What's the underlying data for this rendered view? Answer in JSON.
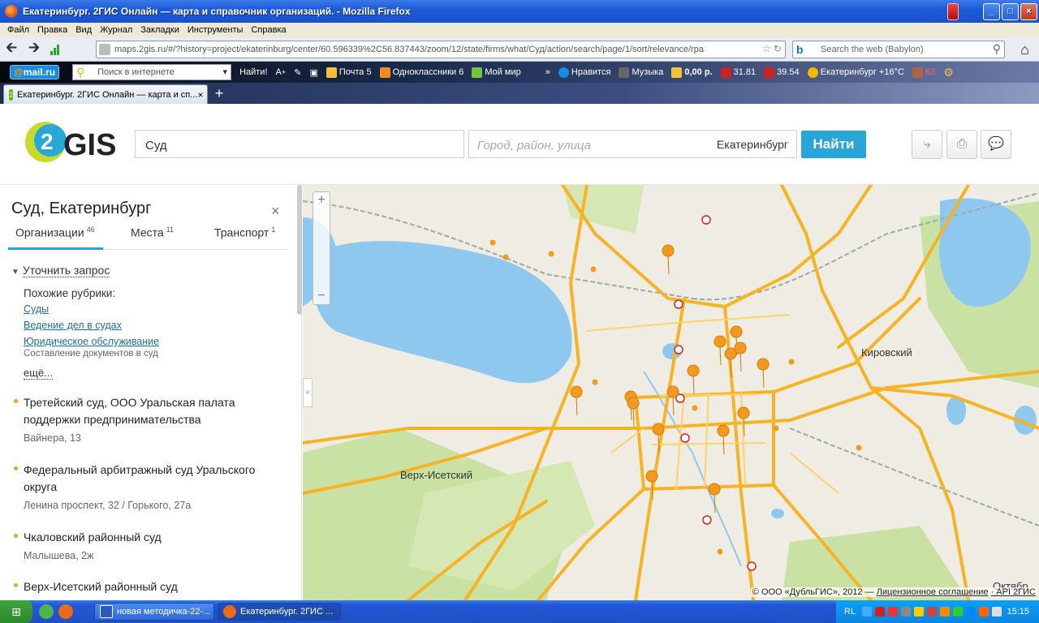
{
  "window": {
    "title": "Екатеринбург. 2ГИС Онлайн — карта и справочник организаций. - Mozilla Firefox",
    "buttons": [
      "_",
      "□",
      "×"
    ]
  },
  "menu": [
    "Файл",
    "Правка",
    "Вид",
    "Журнал",
    "Закладки",
    "Инструменты",
    "Справка"
  ],
  "nav": {
    "url": "maps.2gis.ru/#/?history=project/ekaterinburg/center/60.596339%2C56.837443/zoom/12/state/firms/what/Суд/action/search/page/1/sort/relevance/rpa",
    "websearch_placeholder": "Search the web (Babylon)"
  },
  "toolbar": {
    "mailru_a": "@",
    "mailru_b": "mail.ru",
    "search_placeholder": "Поиск в интернете",
    "find": "Найти!",
    "items": [
      "Почта 5",
      "Одноклассники 6",
      "Мой мир",
      "»",
      "Нравится",
      "Музыка",
      "0,00 р.",
      "31.81",
      "39.54",
      "Екатеринбург +16°C",
      "63"
    ]
  },
  "tab": {
    "title": "Екатеринбург. 2ГИС Онлайн — карта и сп...",
    "close": "×",
    "new": "+"
  },
  "gis": {
    "query": "Суд",
    "where_placeholder": "Город, район, улица",
    "city": "Екатеринбург",
    "find_button": "Найти"
  },
  "sidebar": {
    "title": "Суд, Екатеринбург",
    "close": "×",
    "tabs": [
      {
        "label": "Организации",
        "count": "46"
      },
      {
        "label": "Места",
        "count": "11"
      },
      {
        "label": "Транспорт",
        "count": "1"
      }
    ],
    "refine": "Уточнить запрос",
    "similar_label": "Похожие рубрики:",
    "rubrics": [
      "Суды",
      "Ведение дел в судах",
      "Юридическое обслуживание"
    ],
    "rubric_sub": "Составление документов в суд",
    "more": "ещё...",
    "firms": [
      {
        "name": "Третейский суд, ООО Уральская палата поддержки предпринимательства",
        "address": "Вайнера, 13"
      },
      {
        "name": "Федеральный арбитражный суд Уральского округа",
        "address": "Ленина проспект, 32 / Горького, 27а"
      },
      {
        "name": "Чкаловский районный суд",
        "address": "Малышева, 2ж"
      },
      {
        "name": "Верх-Исетский районный суд",
        "address": ""
      }
    ]
  },
  "map": {
    "labels": [
      "Кировский",
      "Верх-Исетский",
      "Октябр"
    ],
    "copyright_a": "© ООО «ДубльГИС», 2012 —",
    "copyright_b": "Лицензионное соглашение",
    "copyright_c": "· API 2ГИС",
    "zoom_in": "+",
    "zoom_out": "−",
    "collapse": "«",
    "colors": {
      "water": "#8fc8ee",
      "park": "#c9e2a4",
      "road": "#f6b325",
      "marker": "#f39a1e"
    }
  },
  "taskbar": {
    "items": [
      "новая методичка-22-...",
      "Екатеринбург. 2ГИС ..."
    ],
    "lang": "RL",
    "clock": "15:15"
  }
}
